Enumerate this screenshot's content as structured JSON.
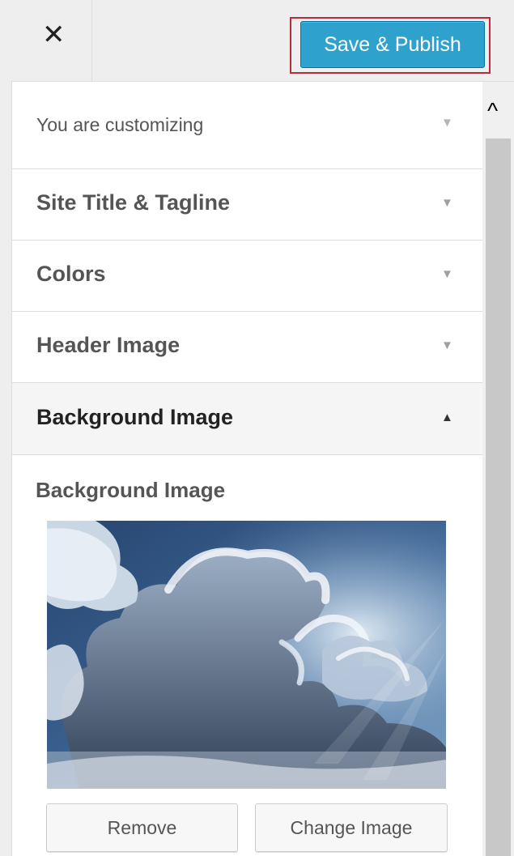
{
  "header": {
    "close_label": "✕",
    "publish_label": "Save & Publish",
    "publish_color": "#2ea2cc",
    "highlight_color": "#b92b38"
  },
  "sections": [
    {
      "label": "You are customizing",
      "state": "collapsed",
      "arrow": "▼"
    },
    {
      "label": "Site Title & Tagline",
      "state": "collapsed",
      "arrow": "▼"
    },
    {
      "label": "Colors",
      "state": "collapsed",
      "arrow": "▼"
    },
    {
      "label": "Header Image",
      "state": "collapsed",
      "arrow": "▼"
    },
    {
      "label": "Background Image",
      "state": "expanded",
      "arrow": "▲"
    }
  ],
  "background_control": {
    "label": "Background Image",
    "image_icon": "sky-clouds-image",
    "remove_label": "Remove",
    "change_label": "Change Image"
  },
  "scrollbar": {
    "up_arrow": "^"
  }
}
